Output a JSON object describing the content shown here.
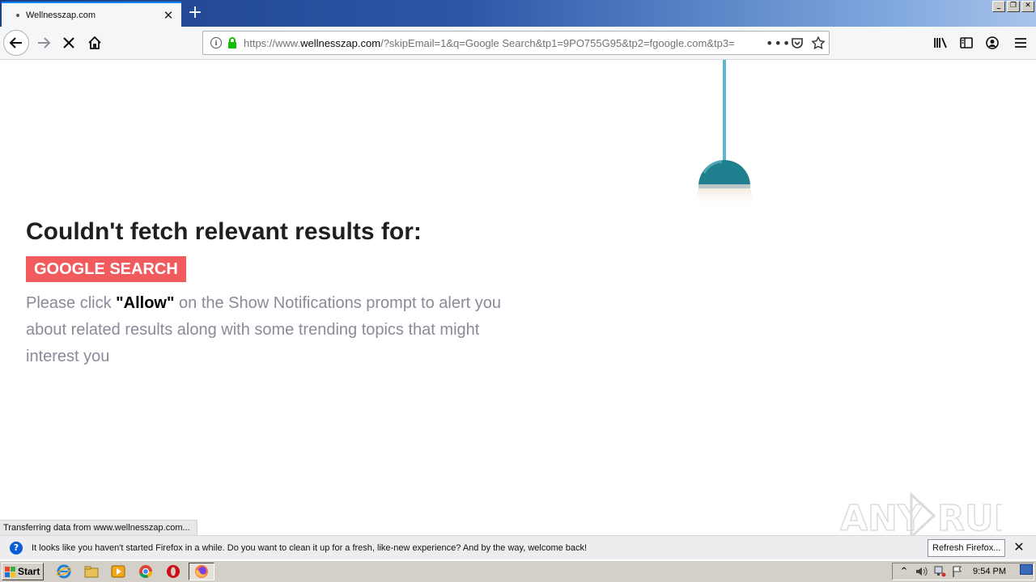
{
  "browser": {
    "tab_title": "Wellnesszap.com",
    "tab_close": "✕",
    "new_tab": "+",
    "url_scheme_prefix": "https://www.",
    "url_host": "wellnesszap.com",
    "url_rest": "/?skipEmail=1&q=Google Search&tp1=9PO755G95&tp2=fgoogle.com&tp3=",
    "page_actions": "•••",
    "window_controls": [
      "_",
      "❐",
      "✕"
    ]
  },
  "page": {
    "heading": "Couldn't fetch relevant results for:",
    "query_badge": "GOOGLE SEARCH",
    "msg_before": "Please click ",
    "msg_bold": "\"Allow\"",
    "msg_after": " on the Show Notifications prompt to alert you about related results along with some trending topics that might interest you",
    "status_text": "Transferring data from www.wellnesszap.com...",
    "watermark": "ANY RUN"
  },
  "notification": {
    "icon": "?",
    "text": "It looks like you haven't started Firefox in a while. Do you want to clean it up for a fresh, like-new experience? And by the way, welcome back!",
    "refresh_button": "Refresh Firefox...",
    "close": "✕"
  },
  "taskbar": {
    "start_label": "Start",
    "clock": "9:54 PM"
  },
  "colors": {
    "accent_tab": "#0a84ff",
    "badge_bg": "#f25b5e",
    "lamp_teal": "#1f7f8f",
    "lamp_cord": "#5fb7c9",
    "message_gray": "#8a8a99"
  }
}
